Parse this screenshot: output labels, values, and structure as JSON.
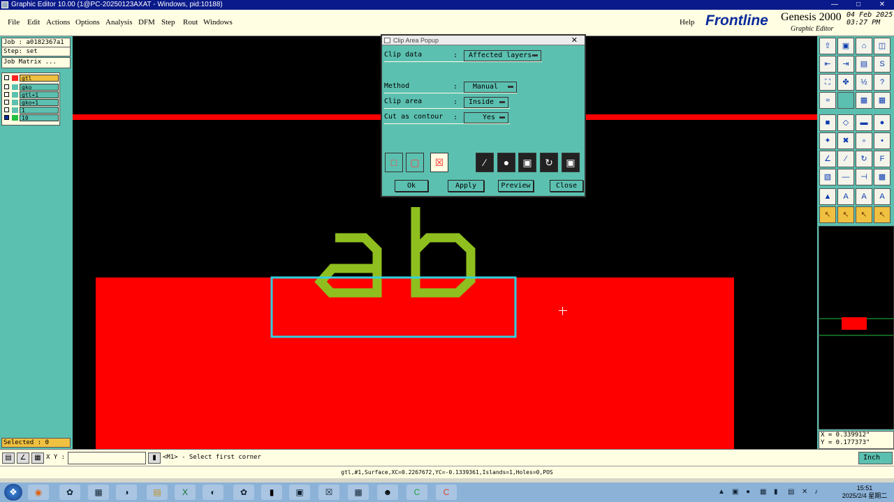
{
  "window": {
    "title": "Graphic Editor 10.00 (1@PC-20250123AXAT - Windows, pid:10188)"
  },
  "menu": [
    "File",
    "Edit",
    "Actions",
    "Options",
    "Analysis",
    "DFM",
    "Step",
    "Rout",
    "Windows"
  ],
  "help_label": "Help",
  "brand": {
    "logo": "Frontline",
    "product": "Genesis 2000",
    "subtitle": "Graphic Editor",
    "date": "04 Feb 2025",
    "time": "03:27 PM"
  },
  "left_panel": {
    "job": "Job : a0182367a1",
    "step": "Step: set",
    "job_matrix": "Job Matrix ...",
    "layers": [
      {
        "name": "gtl",
        "color": "#ff2020",
        "active": true
      },
      {
        "name": "gko",
        "color": "#000000",
        "active": false
      },
      {
        "name": "gtl+1",
        "color": "#000000",
        "active": false
      },
      {
        "name": "gko+1",
        "color": "#000000",
        "active": false
      },
      {
        "name": "1",
        "color": "#000000",
        "active": false
      },
      {
        "name": "10",
        "color": "#20c040",
        "active": false
      }
    ],
    "selected": "Selected : 0"
  },
  "dialog": {
    "title": "Clip Area Popup",
    "fields": [
      {
        "label": "Clip data",
        "value": "Affected layers"
      },
      {
        "label": "Method",
        "value": "Manual"
      },
      {
        "label": "Clip area",
        "value": "Inside"
      },
      {
        "label": "Cut as contour",
        "value": "Yes"
      }
    ],
    "colon": ":",
    "buttons": [
      "Ok",
      "Apply",
      "Preview",
      "Close"
    ]
  },
  "coords": {
    "x": "X = 0.339912\"",
    "y": "Y = 0.177373\""
  },
  "status": {
    "xy_label": "X Y :",
    "message": "<M1> - Select first corner",
    "unit": "Inch"
  },
  "info": "gtl,#1,Surface,XC=0.2267672,YC=-0.1339361,Islands=1,Holes=0,POS",
  "taskbar": {
    "time": "15:51",
    "date": "2025/2/4 星期二"
  },
  "colors": {
    "copper": "#ff0000",
    "text": "#8fbf1f",
    "clip": "#30d0e0",
    "panel": "#5cc0b0"
  }
}
